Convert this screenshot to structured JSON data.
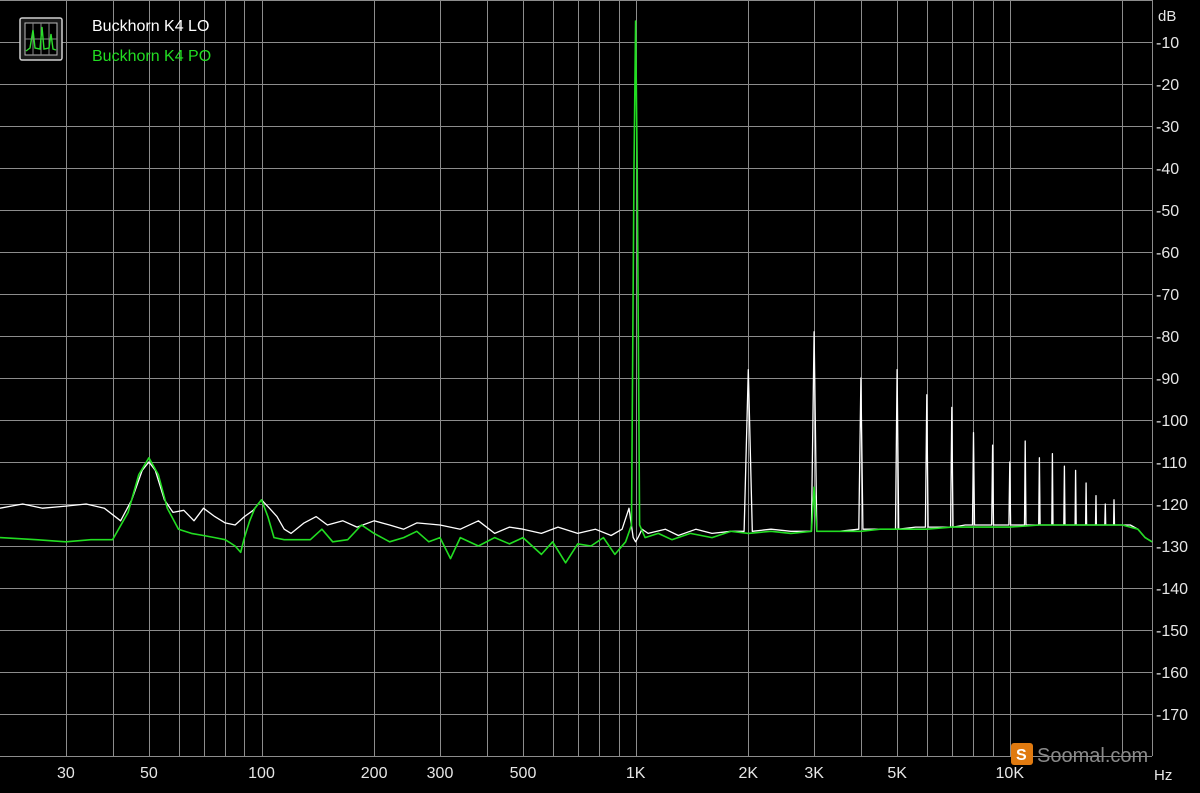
{
  "chart_data": {
    "type": "line",
    "title": "",
    "xlabel": "",
    "ylabel": "",
    "x_unit": "Hz",
    "y_unit": "dB",
    "x_scale": "log",
    "xlim": [
      20,
      24000
    ],
    "ylim": [
      -180,
      0
    ],
    "grid": true,
    "legend_position": "top-left",
    "background_color": "#000000",
    "grid_color": "#8c8c8c",
    "x_ticks": [
      {
        "value": 30,
        "label": "30"
      },
      {
        "value": 50,
        "label": "50"
      },
      {
        "value": 100,
        "label": "100"
      },
      {
        "value": 200,
        "label": "200"
      },
      {
        "value": 300,
        "label": "300"
      },
      {
        "value": 500,
        "label": "500"
      },
      {
        "value": 1000,
        "label": "1K"
      },
      {
        "value": 2000,
        "label": "2K"
      },
      {
        "value": 3000,
        "label": "3K"
      },
      {
        "value": 5000,
        "label": "5K"
      },
      {
        "value": 10000,
        "label": "10K"
      }
    ],
    "y_ticks": [
      {
        "value": -10,
        "label": "-10"
      },
      {
        "value": -20,
        "label": "-20"
      },
      {
        "value": -30,
        "label": "-30"
      },
      {
        "value": -40,
        "label": "-40"
      },
      {
        "value": -50,
        "label": "-50"
      },
      {
        "value": -60,
        "label": "-60"
      },
      {
        "value": -70,
        "label": "-70"
      },
      {
        "value": -80,
        "label": "-80"
      },
      {
        "value": -90,
        "label": "-90"
      },
      {
        "value": -100,
        "label": "-100"
      },
      {
        "value": -110,
        "label": "-110"
      },
      {
        "value": -120,
        "label": "-120"
      },
      {
        "value": -130,
        "label": "-130"
      },
      {
        "value": -140,
        "label": "-140"
      },
      {
        "value": -150,
        "label": "-150"
      },
      {
        "value": -160,
        "label": "-160"
      },
      {
        "value": -170,
        "label": "-170"
      }
    ],
    "series": [
      {
        "name": "Buckhorn K4 LO",
        "color": "#ffffff",
        "points": [
          [
            20,
            -121
          ],
          [
            23,
            -120
          ],
          [
            26,
            -121
          ],
          [
            30,
            -120.5
          ],
          [
            34,
            -120
          ],
          [
            38,
            -121
          ],
          [
            42,
            -124
          ],
          [
            45,
            -119
          ],
          [
            48,
            -112
          ],
          [
            50,
            -110
          ],
          [
            52,
            -112
          ],
          [
            55,
            -119
          ],
          [
            58,
            -122
          ],
          [
            62,
            -121.5
          ],
          [
            66,
            -124
          ],
          [
            70,
            -121
          ],
          [
            75,
            -123
          ],
          [
            80,
            -124.5
          ],
          [
            85,
            -125
          ],
          [
            90,
            -123
          ],
          [
            95,
            -121.5
          ],
          [
            100,
            -119
          ],
          [
            105,
            -121
          ],
          [
            110,
            -123
          ],
          [
            115,
            -126
          ],
          [
            120,
            -127
          ],
          [
            130,
            -124.5
          ],
          [
            140,
            -123
          ],
          [
            150,
            -125
          ],
          [
            165,
            -124
          ],
          [
            180,
            -125.5
          ],
          [
            200,
            -124
          ],
          [
            220,
            -125
          ],
          [
            240,
            -126
          ],
          [
            260,
            -124.5
          ],
          [
            300,
            -125
          ],
          [
            340,
            -126
          ],
          [
            380,
            -124
          ],
          [
            420,
            -127
          ],
          [
            460,
            -125.5
          ],
          [
            500,
            -126
          ],
          [
            560,
            -127
          ],
          [
            620,
            -125.5
          ],
          [
            700,
            -127
          ],
          [
            780,
            -126
          ],
          [
            860,
            -127.5
          ],
          [
            920,
            -126
          ],
          [
            960,
            -121
          ],
          [
            985,
            -128
          ],
          [
            1000,
            -129
          ],
          [
            1015,
            -128
          ],
          [
            1040,
            -126
          ],
          [
            1080,
            -127
          ],
          [
            1200,
            -126
          ],
          [
            1300,
            -127.5
          ],
          [
            1450,
            -126
          ],
          [
            1600,
            -127
          ],
          [
            1800,
            -126.5
          ],
          [
            1950,
            -126.5
          ],
          [
            2000,
            -88
          ],
          [
            2050,
            -126.5
          ],
          [
            2300,
            -126
          ],
          [
            2600,
            -126.5
          ],
          [
            2950,
            -126.5
          ],
          [
            3000,
            -79
          ],
          [
            3050,
            -126.5
          ],
          [
            3500,
            -126.5
          ],
          [
            3950,
            -126
          ],
          [
            4000,
            -90
          ],
          [
            4050,
            -126
          ],
          [
            4500,
            -126
          ],
          [
            4950,
            -126
          ],
          [
            5000,
            -88
          ],
          [
            5050,
            -126
          ],
          [
            5600,
            -125.5
          ],
          [
            5950,
            -125.5
          ],
          [
            6000,
            -94
          ],
          [
            6050,
            -125.5
          ],
          [
            6600,
            -125.5
          ],
          [
            6950,
            -125.5
          ],
          [
            7000,
            -97
          ],
          [
            7050,
            -125.5
          ],
          [
            7600,
            -125
          ],
          [
            7950,
            -125
          ],
          [
            8000,
            -103
          ],
          [
            8050,
            -125
          ],
          [
            8600,
            -125
          ],
          [
            8950,
            -125
          ],
          [
            9000,
            -106
          ],
          [
            9050,
            -125
          ],
          [
            9600,
            -125
          ],
          [
            9950,
            -125
          ],
          [
            10000,
            -110
          ],
          [
            10050,
            -125
          ],
          [
            10600,
            -125
          ],
          [
            10950,
            -125
          ],
          [
            11000,
            -105
          ],
          [
            11050,
            -125
          ],
          [
            11600,
            -125
          ],
          [
            11950,
            -125
          ],
          [
            12000,
            -109
          ],
          [
            12050,
            -125
          ],
          [
            12600,
            -125
          ],
          [
            12950,
            -125
          ],
          [
            13000,
            -108
          ],
          [
            13050,
            -125
          ],
          [
            13600,
            -125
          ],
          [
            13950,
            -125
          ],
          [
            14000,
            -111
          ],
          [
            14050,
            -125
          ],
          [
            14600,
            -125
          ],
          [
            14950,
            -125
          ],
          [
            15000,
            -112
          ],
          [
            15050,
            -125
          ],
          [
            15600,
            -125
          ],
          [
            15950,
            -125
          ],
          [
            16000,
            -115
          ],
          [
            16050,
            -125
          ],
          [
            16600,
            -125
          ],
          [
            16950,
            -125
          ],
          [
            17000,
            -118
          ],
          [
            17050,
            -125
          ],
          [
            17600,
            -125
          ],
          [
            17950,
            -125
          ],
          [
            18000,
            -120
          ],
          [
            18050,
            -125
          ],
          [
            18600,
            -125
          ],
          [
            18950,
            -125
          ],
          [
            19000,
            -119
          ],
          [
            19050,
            -125
          ],
          [
            20000,
            -125
          ],
          [
            21000,
            -125
          ],
          [
            22000,
            -126
          ],
          [
            23000,
            -128
          ],
          [
            24000,
            -129
          ]
        ]
      },
      {
        "name": "Buckhorn K4 PO",
        "color": "#22dd22",
        "points": [
          [
            20,
            -128
          ],
          [
            25,
            -128.5
          ],
          [
            30,
            -129
          ],
          [
            35,
            -128.5
          ],
          [
            40,
            -128.5
          ],
          [
            44,
            -122
          ],
          [
            47,
            -113
          ],
          [
            50,
            -109
          ],
          [
            53,
            -113
          ],
          [
            56,
            -121
          ],
          [
            60,
            -126
          ],
          [
            65,
            -127
          ],
          [
            70,
            -127.5
          ],
          [
            75,
            -128
          ],
          [
            80,
            -128.5
          ],
          [
            85,
            -130
          ],
          [
            88,
            -131.5
          ],
          [
            90,
            -128
          ],
          [
            93,
            -124
          ],
          [
            96,
            -121
          ],
          [
            100,
            -119
          ],
          [
            104,
            -123
          ],
          [
            108,
            -128
          ],
          [
            115,
            -128.5
          ],
          [
            125,
            -128.5
          ],
          [
            135,
            -128.5
          ],
          [
            145,
            -126
          ],
          [
            155,
            -129
          ],
          [
            170,
            -128.5
          ],
          [
            185,
            -125
          ],
          [
            200,
            -127
          ],
          [
            220,
            -129
          ],
          [
            240,
            -128
          ],
          [
            260,
            -126.5
          ],
          [
            280,
            -129
          ],
          [
            300,
            -128
          ],
          [
            320,
            -133
          ],
          [
            340,
            -128
          ],
          [
            380,
            -130
          ],
          [
            420,
            -128
          ],
          [
            460,
            -129.5
          ],
          [
            500,
            -128
          ],
          [
            560,
            -132
          ],
          [
            600,
            -129
          ],
          [
            650,
            -134
          ],
          [
            700,
            -129.5
          ],
          [
            760,
            -130
          ],
          [
            820,
            -128
          ],
          [
            880,
            -132
          ],
          [
            940,
            -129
          ],
          [
            975,
            -125
          ],
          [
            990,
            -40
          ],
          [
            1000,
            -5
          ],
          [
            1010,
            -40
          ],
          [
            1025,
            -125
          ],
          [
            1060,
            -128
          ],
          [
            1150,
            -127
          ],
          [
            1250,
            -128.5
          ],
          [
            1400,
            -127
          ],
          [
            1600,
            -128
          ],
          [
            1800,
            -126.5
          ],
          [
            2000,
            -127
          ],
          [
            2300,
            -126.5
          ],
          [
            2600,
            -127
          ],
          [
            2950,
            -126.5
          ],
          [
            3000,
            -116
          ],
          [
            3050,
            -126.5
          ],
          [
            3500,
            -126.5
          ],
          [
            4000,
            -126.5
          ],
          [
            4500,
            -126
          ],
          [
            5000,
            -126
          ],
          [
            6000,
            -126
          ],
          [
            7000,
            -125.5
          ],
          [
            8000,
            -125.5
          ],
          [
            9000,
            -125.5
          ],
          [
            10000,
            -125.5
          ],
          [
            12000,
            -125
          ],
          [
            14000,
            -125
          ],
          [
            16000,
            -125
          ],
          [
            18000,
            -125
          ],
          [
            20000,
            -125
          ],
          [
            22000,
            -126
          ],
          [
            23000,
            -128
          ],
          [
            24000,
            -129
          ]
        ]
      }
    ]
  },
  "watermark": {
    "text": "Soomal.com",
    "badge_glyph": "S"
  },
  "icon": {
    "name": "spectrum-window-icon",
    "color": "#c8c8c8"
  }
}
